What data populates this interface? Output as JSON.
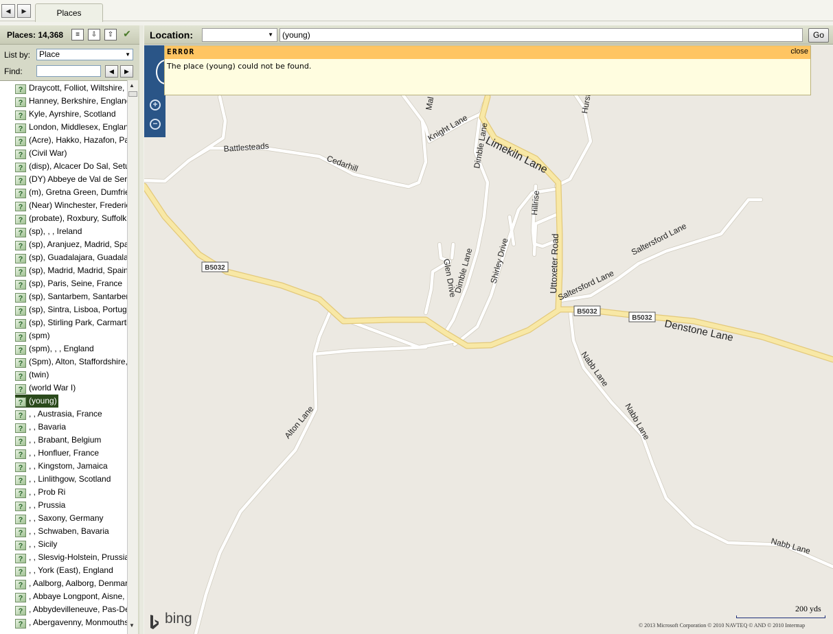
{
  "nav": {
    "back": "◀",
    "forward": "▶"
  },
  "tab": {
    "label": "Places"
  },
  "places_panel": {
    "count_label": "Places: 14,368",
    "list_by_label": "List by:",
    "list_by_value": "Place",
    "find_label": "Find:",
    "find_value": "",
    "items": [
      "Draycott, Folliot, Wiltshire, England",
      "Hanney, Berkshire, England",
      "Kyle, Ayrshire, Scotland",
      "London, Middlesex, England",
      "(Acre), Hakko, Hazafon, Palestine",
      "(Civil War)",
      "(disp), Alcacer Do Sal, Setubal",
      "(DY) Abbeye de Val de Serey",
      "(m), Gretna Green, Dumfries,",
      "(Near) Winchester, Frederick",
      "(probate), Roxbury, Suffolk, M",
      "(sp), , , Ireland",
      "(sp), Aranjuez, Madrid, Spain",
      "(sp), Guadalajara, Guadalajara",
      "(sp), Madrid, Madrid, Spain",
      "(sp), Paris, Seine, France",
      "(sp), Santarbem, Santarbem,",
      "(sp), Sintra, Lisboa, Portugal",
      "(sp), Stirling Park, Carmarthen",
      "(spm)",
      "(spm), , , England",
      "(Spm), Alton, Staffordshire, E",
      "(twin)",
      "(world War I)",
      "(young)",
      ", , Austrasia, France",
      ", , Bavaria",
      ", , Brabant, Belgium",
      ", , Honfluer, France",
      ", , Kingstom, Jamaica",
      ", , Linlithgow, Scotland",
      ", , Prob Ri",
      ", , Prussia",
      ", , Saxony, Germany",
      ", , Schwaben, Bavaria",
      ", , Sicily",
      ", , Slesvig-Holstein, Prussia",
      ", , York (East), England",
      ", Aalborg, Aalborg, Denmark",
      ", Abbaye Longpont, Aisne, Fr",
      ", Abbydevilleneuve, Pas-De-C",
      ", Abergavenny, Monmouthsh"
    ],
    "selected_index": 24
  },
  "location_bar": {
    "label": "Location:",
    "select_value": "",
    "input_value": "(young)",
    "go_label": "Go"
  },
  "error": {
    "title": "ERROR",
    "close_label": "close",
    "message": "The place (young) could not be found."
  },
  "map": {
    "roads": {
      "battlesteads": "Battlesteads",
      "cedarhill": "Cedarhill",
      "knight_lane": "Knight Lane",
      "dimble_lane_1": "Dimble Lane",
      "dimble_lane_2": "Dimble Lane",
      "limekiln_lane": "Limekiln Lane",
      "hurst": "Hurst",
      "mal": "Mal",
      "hillrise": "Hillrise",
      "uttoxeter_road": "Uttoxeter Road",
      "glen_drive": "Glen Drive",
      "shirley_drive": "Shirley Drive",
      "saltersford_lane_1": "Saltersford Lane",
      "saltersford_lane_2": "Saltersford Lane",
      "b5032_1": "B5032",
      "b5032_2": "B5032",
      "b5032_3": "B5032",
      "denstone_lane": "Denstone Lane",
      "nabb_lane_1": "Nabb Lane",
      "nabb_lane_2": "Nabb Lane",
      "nabb_lane_3": "Nabb Lane",
      "alton_lane": "Alton Lane"
    },
    "bing_label": "bing",
    "scale_label": "200 yds",
    "copyright": "© 2013 Microsoft Corporation   © 2010 NAVTEQ   © AND   © 2010 Intermap",
    "colors": {
      "major_road": "#f8e8a6",
      "major_road_edge": "#e3c97a",
      "minor_road": "#ffffff",
      "background": "#ece9e2",
      "error_header": "#ffc562",
      "error_body": "#fffde0",
      "zoom_bar": "#2a5587"
    }
  }
}
